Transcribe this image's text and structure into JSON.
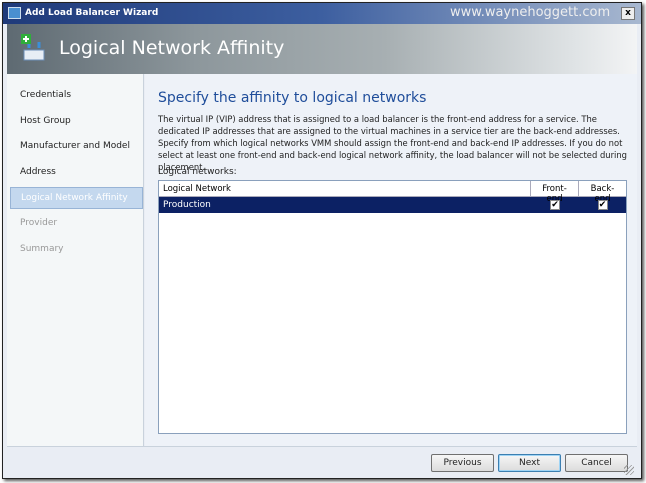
{
  "window": {
    "title": "Add Load Balancer Wizard",
    "watermark": "www.waynehoggett.com",
    "close": "x"
  },
  "header": {
    "title": "Logical Network Affinity"
  },
  "steps": [
    {
      "label": "Credentials",
      "state": "done"
    },
    {
      "label": "Host Group",
      "state": "done"
    },
    {
      "label": "Manufacturer and Model",
      "state": "done"
    },
    {
      "label": "Address",
      "state": "done"
    },
    {
      "label": "Logical Network Affinity",
      "state": "active"
    },
    {
      "label": "Provider",
      "state": "disabled"
    },
    {
      "label": "Summary",
      "state": "disabled"
    }
  ],
  "main": {
    "heading": "Specify the affinity to logical networks",
    "description": "The virtual IP (VIP) address that is assigned to a load balancer is the front-end address for a service. The dedicated IP addresses that are assigned to the virtual machines in a service tier are the back-end addresses. Specify from which logical networks VMM should assign the front-end and back-end IP addresses. If you do not select at least one front-end and back-end logical network affinity, the load balancer will not be selected during placement.",
    "networks_label": "Logical networks:",
    "columns": [
      "Logical Network",
      "Front-end",
      "Back-end"
    ],
    "rows": [
      {
        "name": "Production",
        "front_end": true,
        "back_end": true
      }
    ],
    "check": "✔"
  },
  "buttons": {
    "previous": "Previous",
    "next": "Next",
    "cancel": "Cancel"
  }
}
